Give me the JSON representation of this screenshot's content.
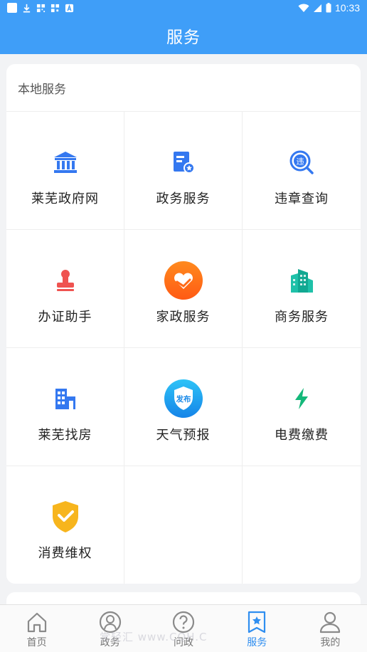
{
  "status_bar": {
    "time": "10:33"
  },
  "header": {
    "title": "服务"
  },
  "section": {
    "title": "本地服务",
    "items": [
      {
        "label": "莱芜政府网",
        "icon": "government-building-icon"
      },
      {
        "label": "政务服务",
        "icon": "document-badge-icon"
      },
      {
        "label": "违章查询",
        "icon": "violation-search-icon"
      },
      {
        "label": "办证助手",
        "icon": "stamp-icon"
      },
      {
        "label": "家政服务",
        "icon": "heart-hands-icon"
      },
      {
        "label": "商务服务",
        "icon": "office-buildings-icon"
      },
      {
        "label": "莱芜找房",
        "icon": "apartment-icon"
      },
      {
        "label": "天气预报",
        "icon": "weather-shield-icon",
        "badge": "发布"
      },
      {
        "label": "电费缴费",
        "icon": "lightning-icon"
      },
      {
        "label": "消费维权",
        "icon": "shield-check-icon"
      }
    ]
  },
  "tabbar": {
    "tabs": [
      {
        "label": "首页",
        "icon": "home-icon"
      },
      {
        "label": "政务",
        "icon": "person-circle-icon"
      },
      {
        "label": "问政",
        "icon": "question-icon"
      },
      {
        "label": "服务",
        "icon": "star-bookmark-icon",
        "active": true
      },
      {
        "label": "我的",
        "icon": "user-icon"
      }
    ]
  },
  "watermark": "常轻汇 www.CQH.C",
  "colors": {
    "primary": "#3f9ef8",
    "active_tab": "#2f8ef0"
  }
}
